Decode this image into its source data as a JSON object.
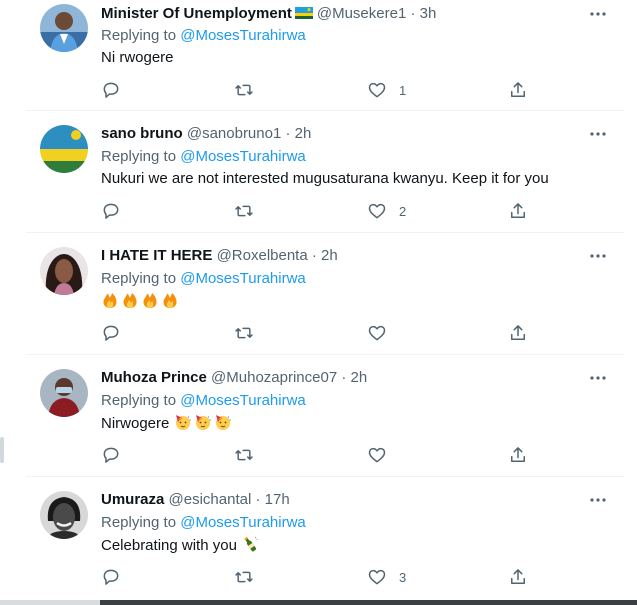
{
  "replying_prefix": "Replying to",
  "tweets": [
    {
      "name": "Minister Of Unemployment",
      "handle": "@Musekere1",
      "sep": "·",
      "time": "3h",
      "reply_to": "@MosesTurahirwa",
      "text": "Ni rwogere",
      "likes": "1",
      "has_flag": true
    },
    {
      "name": "sano bruno",
      "handle": "@sanobruno1",
      "sep": "·",
      "time": "2h",
      "reply_to": "@MosesTurahirwa",
      "text": "Nukuri we are not interested mugusaturana kwanyu. Keep it for you",
      "likes": "2"
    },
    {
      "name": "I HATE IT HERE",
      "handle": "@Roxelbenta",
      "sep": "·",
      "time": "2h",
      "reply_to": "@MosesTurahirwa",
      "text": "",
      "emojis": [
        "fire-emoji",
        "fire-emoji",
        "fire-emoji",
        "fire-emoji"
      ],
      "likes": ""
    },
    {
      "name": "Muhoza Prince",
      "handle": "@Muhozaprince07",
      "sep": "·",
      "time": "2h",
      "reply_to": "@MosesTurahirwa",
      "text": "Nirwogere",
      "emojis": [
        "partying-face-emoji",
        "partying-face-emoji",
        "partying-face-emoji"
      ],
      "likes": ""
    },
    {
      "name": "Umuraza",
      "handle": "@esichantal",
      "sep": "·",
      "time": "17h",
      "reply_to": "@MosesTurahirwa",
      "text": "Celebrating with you",
      "emojis": [
        "champagne-emoji"
      ],
      "likes": "3"
    }
  ],
  "colors": {
    "link": "#1d9bf0",
    "muted": "#536471",
    "text": "#0f1419",
    "divider": "#eff3f4"
  }
}
